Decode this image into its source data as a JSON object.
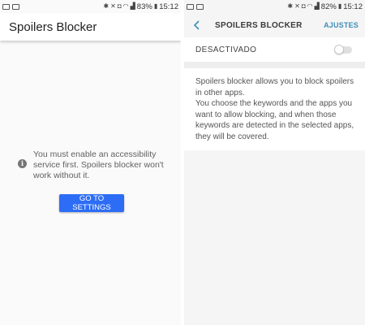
{
  "left": {
    "status": {
      "battery": "83%",
      "time": "15:12"
    },
    "app_title": "Spoilers Blocker",
    "message": "You must enable an accessibility service first. Spoilers blocker won't work without it.",
    "button_label": "GO TO SETTINGS",
    "button_color": "#2d6df6"
  },
  "right": {
    "status": {
      "battery": "82%",
      "time": "15:12"
    },
    "title": "SPOILERS BLOCKER",
    "action_label": "AJUSTES",
    "toggle_label": "DESACTIVADO",
    "toggle_on": false,
    "description_1": "Spoilers blocker allows you to block spoilers in other apps.",
    "description_2": "You choose the keywords and the apps you want to allow blocking, and when those keywords are detected in the selected apps, they will be covered."
  }
}
